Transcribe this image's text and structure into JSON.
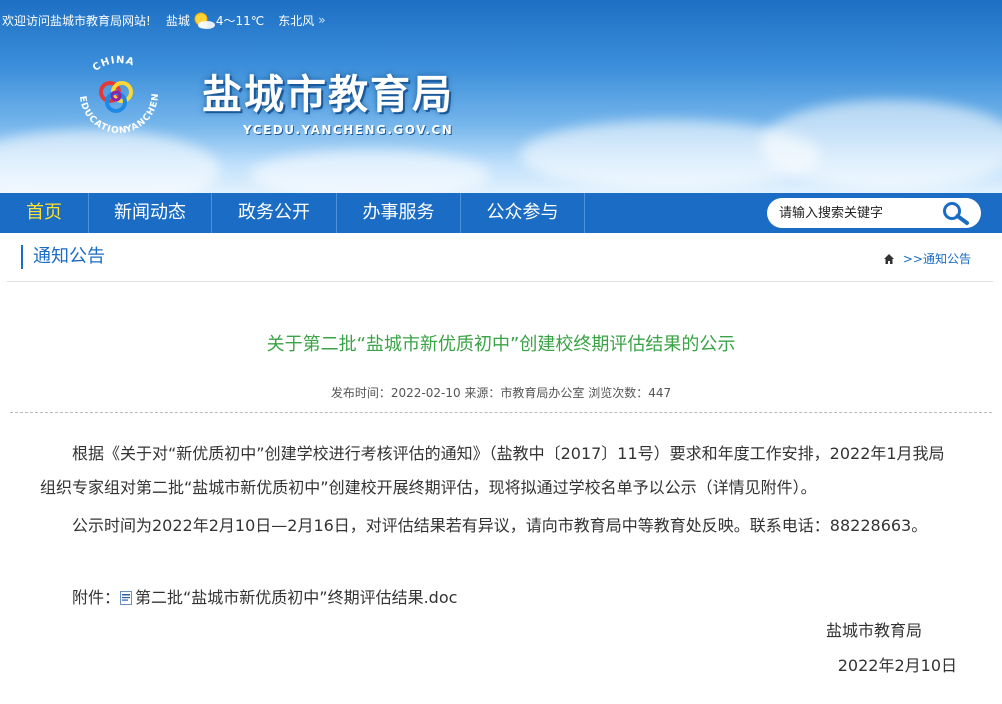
{
  "topbar": {
    "welcome": "欢迎访问盐城市教育局网站!",
    "city": "盐城",
    "weather_icon": "sun-cloud-icon",
    "temperature": "4～11℃",
    "wind": "东北风"
  },
  "header": {
    "site_title": "盐城市教育局",
    "site_domain": "YCEDU.YANCHENG.GOV.CN",
    "logo_text_top": "CHINA",
    "logo_text_left": "EDUCATION",
    "logo_text_right": "YANCHENG"
  },
  "nav": {
    "items": [
      {
        "label": "首页"
      },
      {
        "label": "新闻动态"
      },
      {
        "label": "政务公开"
      },
      {
        "label": "办事服务"
      },
      {
        "label": "公众参与"
      }
    ],
    "search_placeholder": "请输入搜索关键字"
  },
  "breadcrumb": {
    "section_title": "通知公告",
    "separator": ">>",
    "current": "通知公告"
  },
  "article": {
    "title": "关于第二批“盐城市新优质初中”创建校终期评估结果的公示",
    "meta": "发布时间：2022-02-10 来源：市教育局办公室 浏览次数：447",
    "paragraph1": "根据《关于对“新优质初中”创建学校进行考核评估的通知》（盐教中〔2017〕11号）要求和年度工作安排，2022年1月我局组织专家组对第二批“盐城市新优质初中”创建校开展终期评估，现将拟通过学校名单予以公示（详情见附件）。",
    "paragraph2": "公示时间为2022年2月10日—2月16日，对评估结果若有异议，请向市教育局中等教育处反映。联系电话：88228663。",
    "attachment_label": "附件：",
    "attachment_file": "第二批“盐城市新优质初中”终期评估结果.doc",
    "signature": "盐城市教育局",
    "date": "2022年2月10日"
  },
  "colors": {
    "nav_bg": "#1a6cc4",
    "nav_home": "#ffe033",
    "title_green": "#3aa346",
    "link_blue": "#1a6cc4"
  }
}
